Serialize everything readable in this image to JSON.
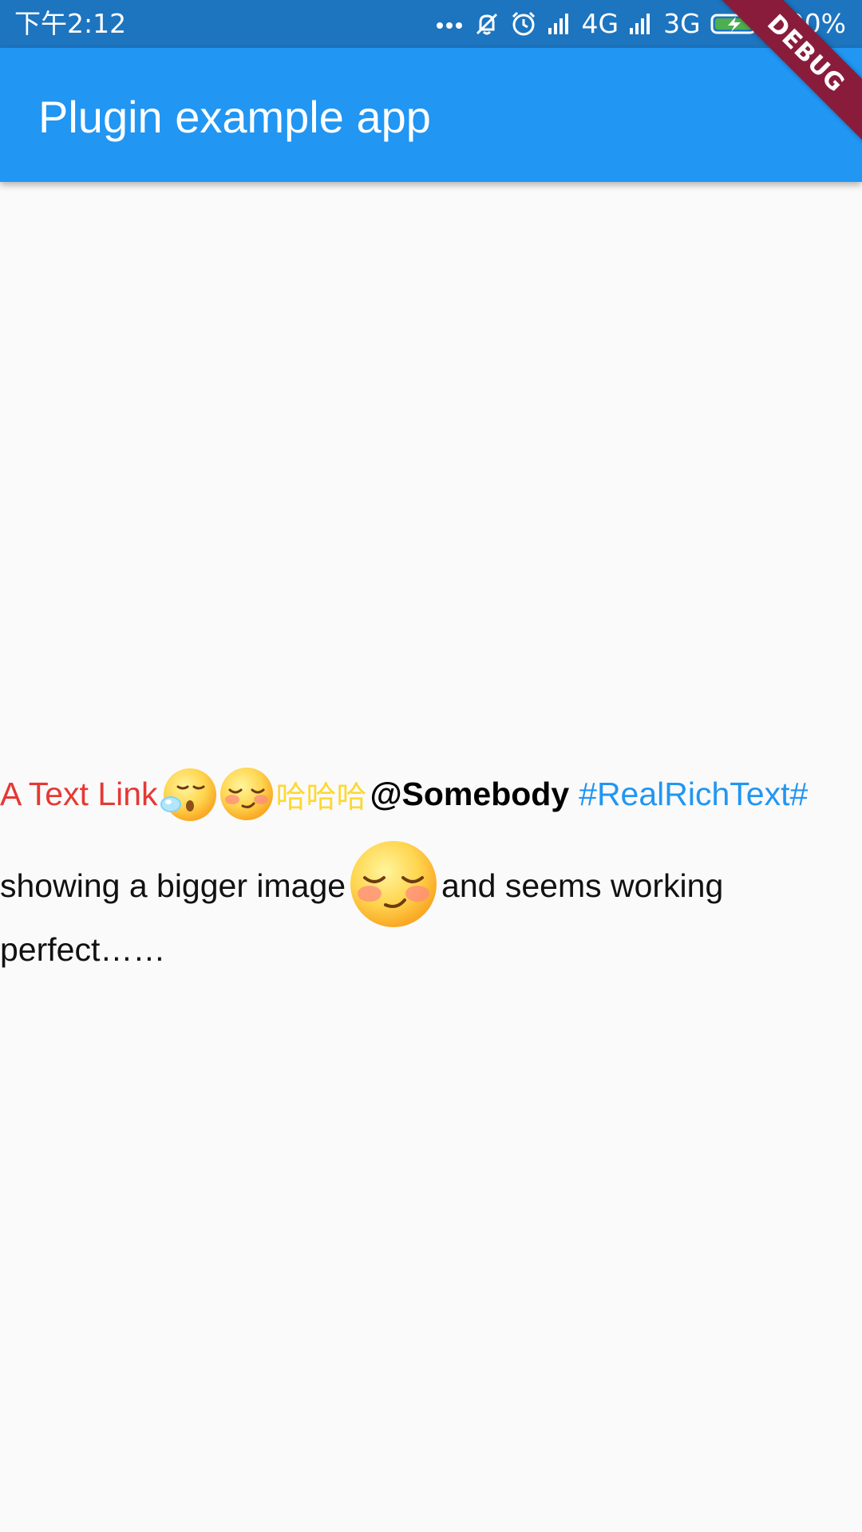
{
  "status_bar": {
    "time": "下午2:12",
    "network_4g": "4G",
    "network_3g": "3G",
    "battery": "100%",
    "icons": [
      "more-dots-icon",
      "mute-icon",
      "alarm-icon",
      "signal-icon",
      "signal-icon",
      "battery-charging-icon"
    ]
  },
  "app_bar": {
    "title": "Plugin example app",
    "color": "#2196f3"
  },
  "debug_banner": {
    "label": "DEBUG"
  },
  "rich_text": {
    "link": "A Text Link",
    "link_color": "#e53935",
    "emoji_1": "sleepy-face-icon",
    "emoji_2": "shy-face-icon",
    "cjk": "哈哈哈",
    "cjk_color": "#fdd835",
    "mention": "@Somebody",
    "topic": "#RealRichText#",
    "topic_color": "#2196f3",
    "line2_before": "showing a bigger image",
    "big_emoji": "shy-face-icon",
    "line2_after": "and seems working",
    "line3": "perfect……"
  }
}
